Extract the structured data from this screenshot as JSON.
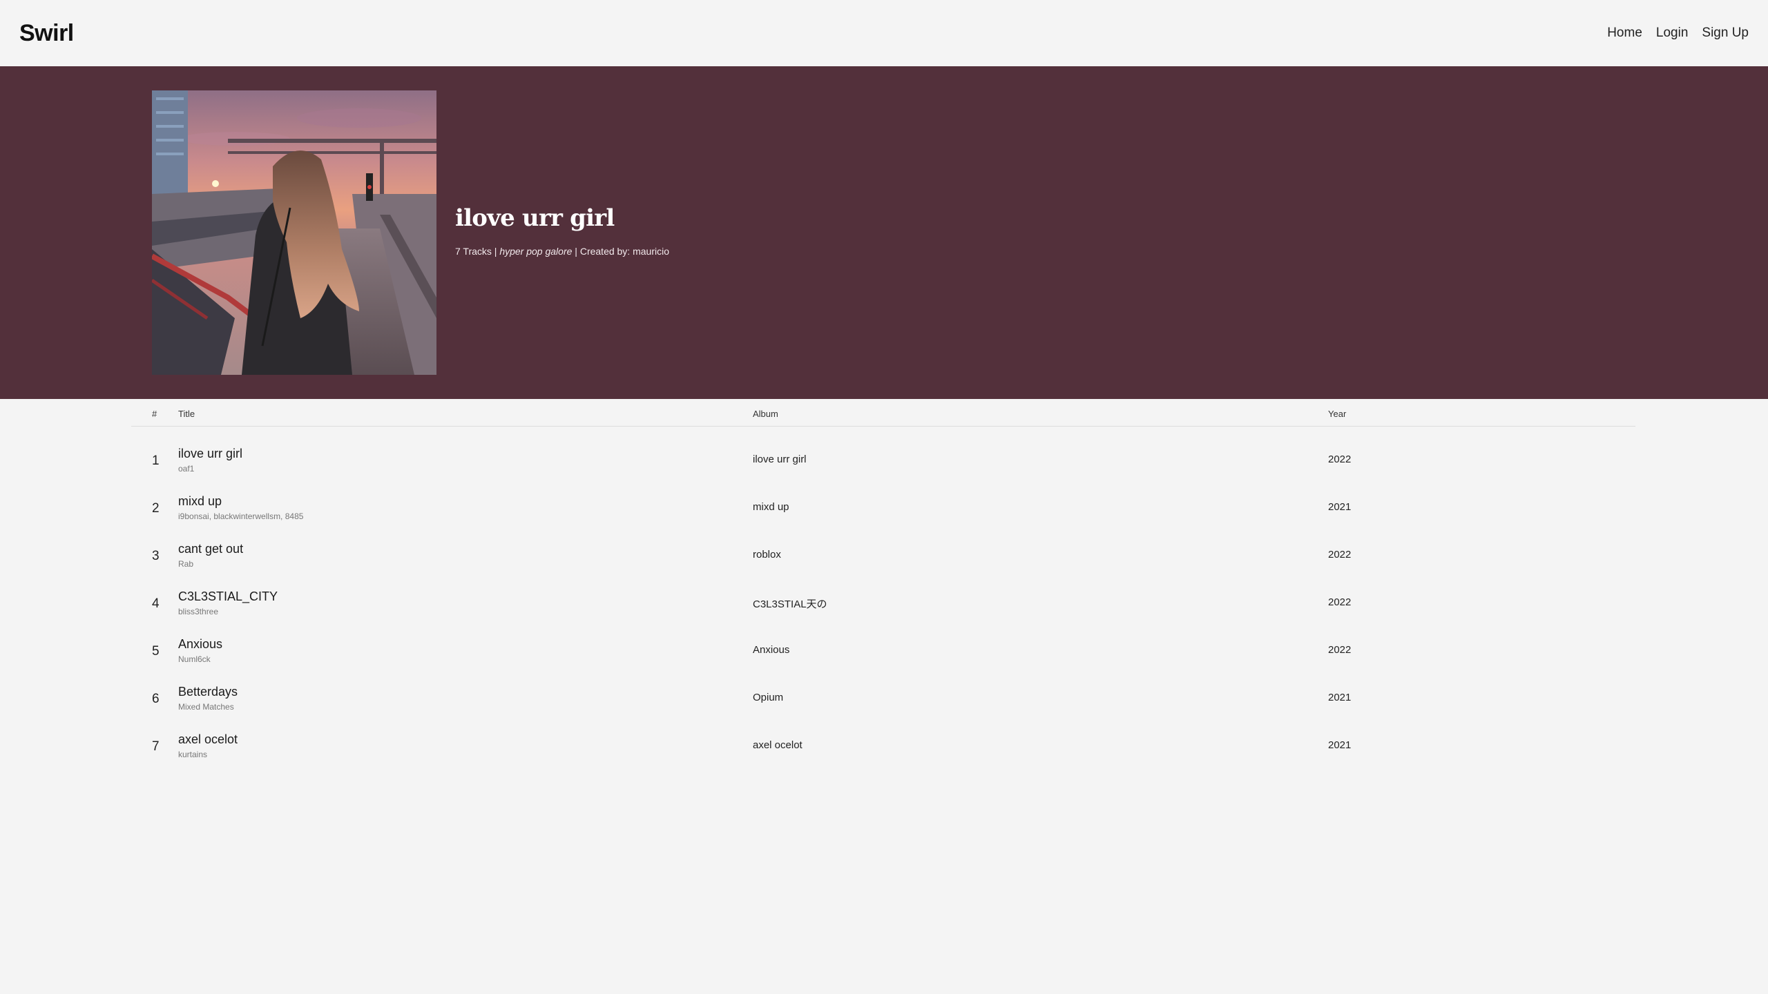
{
  "brand": "Swirl",
  "nav": {
    "home": "Home",
    "login": "Login",
    "signup": "Sign Up"
  },
  "colors": {
    "hero_bg": "#53303b",
    "page_bg": "#f4f4f4"
  },
  "playlist": {
    "title": "ilove urr girl",
    "track_count": "7 Tracks",
    "separator": " | ",
    "genre": "hyper pop galore",
    "created_by_label": "Created by: ",
    "creator": "mauricio",
    "cover_alt": "playlist-cover-photo"
  },
  "table": {
    "headers": {
      "num": "#",
      "title": "Title",
      "album": "Album",
      "year": "Year"
    },
    "rows": [
      {
        "num": "1",
        "title": "ilove urr girl",
        "artist": "oaf1",
        "album": "ilove urr girl",
        "year": "2022"
      },
      {
        "num": "2",
        "title": "mixd up",
        "artist": "i9bonsai, blackwinterwellsm, 8485",
        "album": "mixd up",
        "year": "2021"
      },
      {
        "num": "3",
        "title": "cant get out",
        "artist": "Rab",
        "album": "roblox",
        "year": "2022"
      },
      {
        "num": "4",
        "title": "C3L3STIAL_CITY",
        "artist": "bliss3three",
        "album": "C3L3STIAL天の",
        "year": "2022"
      },
      {
        "num": "5",
        "title": "Anxious",
        "artist": "Numl6ck",
        "album": "Anxious",
        "year": "2022"
      },
      {
        "num": "6",
        "title": "Betterdays",
        "artist": "Mixed Matches",
        "album": "Opium",
        "year": "2021"
      },
      {
        "num": "7",
        "title": "axel ocelot",
        "artist": "kurtains",
        "album": "axel ocelot",
        "year": "2021"
      }
    ]
  }
}
